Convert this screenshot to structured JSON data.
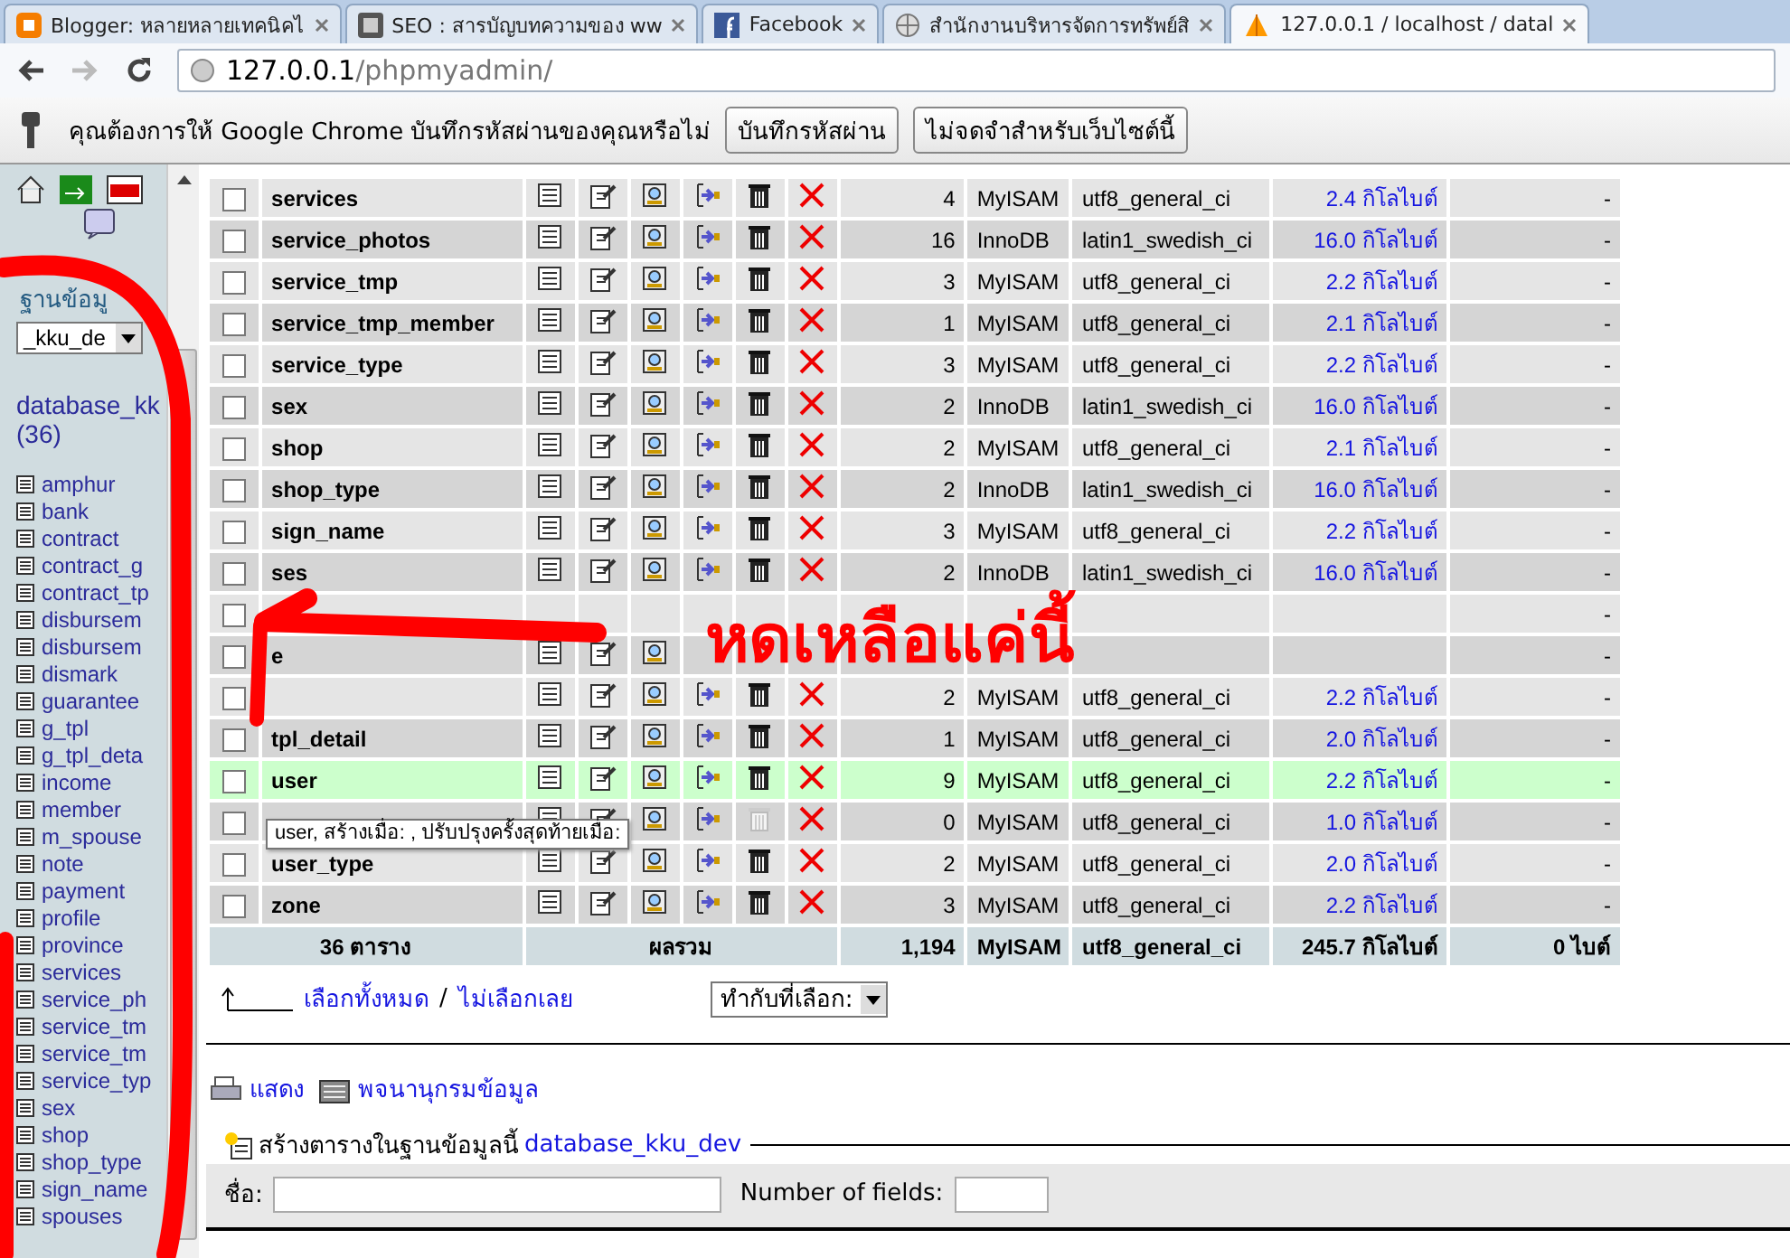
{
  "browser": {
    "tabs": [
      {
        "title": "Blogger: หลายหลายเทคนิคไ",
        "selected": false
      },
      {
        "title": "SEO : สารบัญบทความของ ww",
        "selected": false
      },
      {
        "title": "Facebook",
        "selected": false
      },
      {
        "title": "สำนักงานบริหารจัดการทรัพย์สิ",
        "selected": false
      },
      {
        "title": "127.0.0.1 / localhost / datal",
        "selected": true
      }
    ],
    "address": {
      "host": "127.0.0.1",
      "path": "/phpmyadmin/"
    },
    "infobar": {
      "message": "คุณต้องการให้ Google Chrome บันทึกรหัสผ่านของคุณหรือไม่",
      "buttons": [
        "บันทึกรหัสผ่าน",
        "ไม่จดจำสำหรับเว็บไซต์นี้"
      ]
    }
  },
  "sidebar": {
    "database_label": "ฐานข้อมู",
    "database_select": "_kku_de",
    "database_name": "database_kk",
    "table_count": "(36)",
    "tables": [
      "amphur",
      "bank",
      "contract",
      "contract_g",
      "contract_tp",
      "disbursem",
      "disbursem",
      "dismark",
      "guarantee",
      "g_tpl",
      "g_tpl_deta",
      "income",
      "member",
      "m_spouse",
      "note",
      "payment",
      "profile",
      "province",
      "services",
      "service_ph",
      "service_tm",
      "service_tm",
      "service_typ",
      "sex",
      "shop",
      "shop_type",
      "sign_name",
      "spouses"
    ]
  },
  "tables": [
    {
      "name": "services",
      "rows": "4",
      "engine": "MyISAM",
      "collation": "utf8_general_ci",
      "size": "2.4 กิโลไบต์",
      "overhead": "-",
      "checked": false,
      "highlighted": false,
      "empty": false
    },
    {
      "name": "service_photos",
      "rows": "16",
      "engine": "InnoDB",
      "collation": "latin1_swedish_ci",
      "size": "16.0 กิโลไบต์",
      "overhead": "-",
      "checked": false,
      "highlighted": false,
      "empty": false
    },
    {
      "name": "service_tmp",
      "rows": "3",
      "engine": "MyISAM",
      "collation": "utf8_general_ci",
      "size": "2.2 กิโลไบต์",
      "overhead": "-",
      "checked": false,
      "highlighted": false,
      "empty": false
    },
    {
      "name": "service_tmp_member",
      "rows": "1",
      "engine": "MyISAM",
      "collation": "utf8_general_ci",
      "size": "2.1 กิโลไบต์",
      "overhead": "-",
      "checked": false,
      "highlighted": false,
      "empty": false
    },
    {
      "name": "service_type",
      "rows": "3",
      "engine": "MyISAM",
      "collation": "utf8_general_ci",
      "size": "2.2 กิโลไบต์",
      "overhead": "-",
      "checked": false,
      "highlighted": false,
      "empty": false
    },
    {
      "name": "sex",
      "rows": "2",
      "engine": "InnoDB",
      "collation": "latin1_swedish_ci",
      "size": "16.0 กิโลไบต์",
      "overhead": "-",
      "checked": false,
      "highlighted": false,
      "empty": false
    },
    {
      "name": "shop",
      "rows": "2",
      "engine": "MyISAM",
      "collation": "utf8_general_ci",
      "size": "2.1 กิโลไบต์",
      "overhead": "-",
      "checked": false,
      "highlighted": false,
      "empty": false
    },
    {
      "name": "shop_type",
      "rows": "2",
      "engine": "InnoDB",
      "collation": "latin1_swedish_ci",
      "size": "16.0 กิโลไบต์",
      "overhead": "-",
      "checked": false,
      "highlighted": false,
      "empty": false
    },
    {
      "name": "sign_name",
      "rows": "3",
      "engine": "MyISAM",
      "collation": "utf8_general_ci",
      "size": "2.2 กิโลไบต์",
      "overhead": "-",
      "checked": false,
      "highlighted": false,
      "empty": false
    },
    {
      "name": "ses",
      "rows": "2",
      "engine": "InnoDB",
      "collation": "latin1_swedish_ci",
      "size": "16.0 กิโลไบต์",
      "overhead": "-",
      "checked": false,
      "highlighted": false,
      "empty": false
    },
    {
      "kind": "covered",
      "overhead": "-",
      "checked": false,
      "highlighted": false
    },
    {
      "name": "e",
      "kind": "half-covered",
      "overhead": "-",
      "checked": false,
      "highlighted": false
    },
    {
      "rows": "2",
      "engine": "MyISAM",
      "collation": "utf8_general_ci",
      "size": "2.2 กิโลไบต์",
      "overhead": "-",
      "checked": false,
      "highlighted": false,
      "empty": false
    },
    {
      "name": "tpl_detail",
      "rows": "1",
      "engine": "MyISAM",
      "collation": "utf8_general_ci",
      "size": "2.0 กิโลไบต์",
      "overhead": "-",
      "checked": false,
      "highlighted": false,
      "empty": false
    },
    {
      "name": "user",
      "rows": "9",
      "engine": "MyISAM",
      "collation": "utf8_general_ci",
      "size": "2.2 กิโลไบต์",
      "overhead": "-",
      "checked": false,
      "highlighted": true,
      "empty": false
    },
    {
      "rows": "0",
      "engine": "MyISAM",
      "collation": "utf8_general_ci",
      "size": "1.0 กิโลไบต์",
      "overhead": "-",
      "checked": false,
      "highlighted": false,
      "empty": true,
      "tooltip": "user, สร้างเมื่อ: , ปรับปรุงครั้งสุดท้ายเมื่อ:"
    },
    {
      "name": "user_type",
      "rows": "2",
      "engine": "MyISAM",
      "collation": "utf8_general_ci",
      "size": "2.0 กิโลไบต์",
      "overhead": "-",
      "checked": false,
      "highlighted": false,
      "empty": false
    },
    {
      "name": "zone",
      "rows": "3",
      "engine": "MyISAM",
      "collation": "utf8_general_ci",
      "size": "2.2 กิโลไบต์",
      "overhead": "-",
      "checked": false,
      "highlighted": false,
      "empty": false
    }
  ],
  "summary": {
    "tables": "36 ตาราง",
    "label": "ผลรวม",
    "rows": "1,194",
    "engine": "MyISAM",
    "collation": "utf8_general_ci",
    "size": "245.7 กิโลไบต์",
    "overhead": "0 ไบต์"
  },
  "selection": {
    "check_all": "เลือกทั้งหมด",
    "separator": "/",
    "uncheck_all": "ไม่เลือกเลย",
    "action": "ทำกับที่เลือก:"
  },
  "links": [
    "แสดง",
    "พจนานุกรมข้อมูล"
  ],
  "create": {
    "legend": "สร้างตารางในฐานข้อมูลนี้",
    "database": "database_kku_dev",
    "name_label": "ชื่อ:",
    "fields_label": "Number of fields:"
  },
  "annotation": {
    "text": "หดเหลือแค่นี้"
  }
}
